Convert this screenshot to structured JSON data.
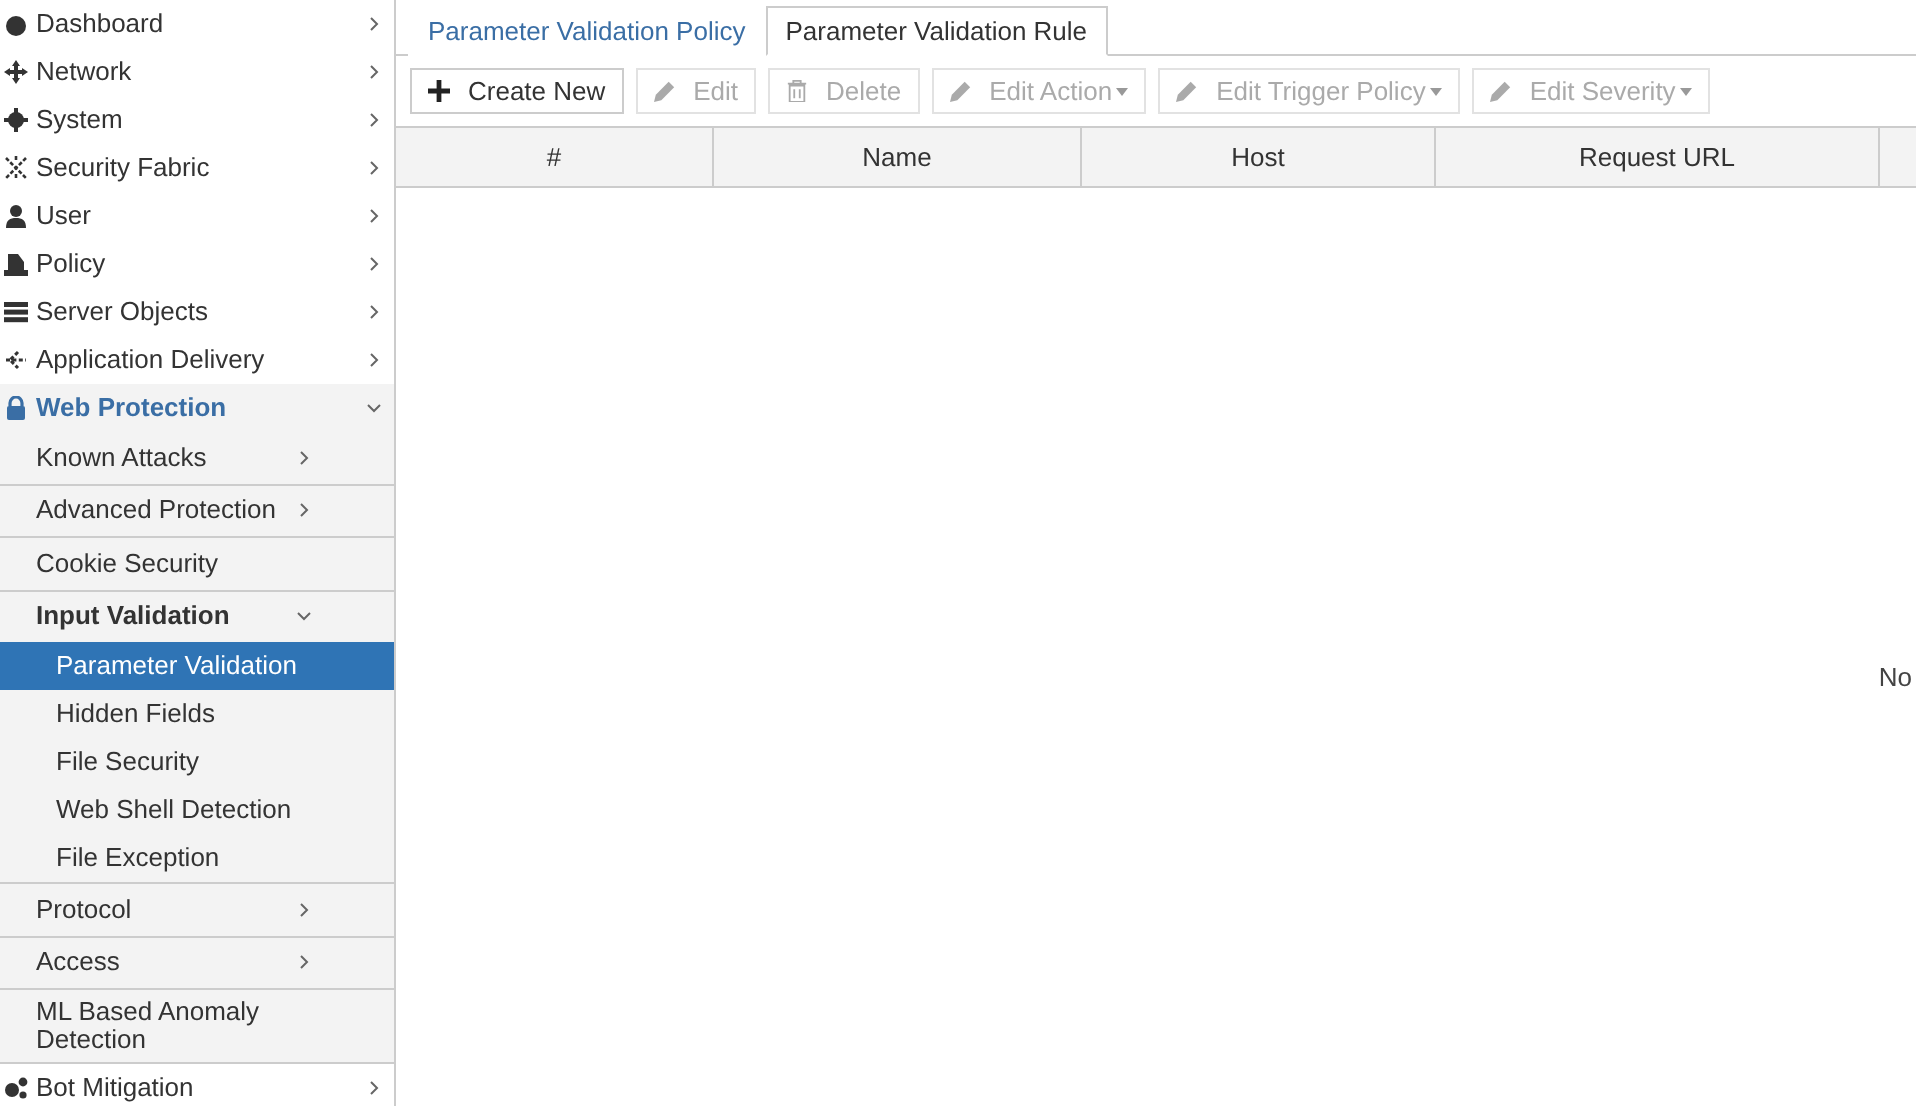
{
  "sidebar": {
    "items": [
      {
        "label": "Dashboard",
        "expanded": false
      },
      {
        "label": "Network",
        "expanded": false
      },
      {
        "label": "System",
        "expanded": false
      },
      {
        "label": "Security Fabric",
        "expanded": false
      },
      {
        "label": "User",
        "expanded": false
      },
      {
        "label": "Policy",
        "expanded": false
      },
      {
        "label": "Server Objects",
        "expanded": false
      },
      {
        "label": "Application Delivery",
        "expanded": false
      },
      {
        "label": "Web Protection",
        "expanded": true,
        "children": [
          {
            "label": "Known Attacks",
            "expanded": false
          },
          {
            "label": "Advanced Protection",
            "expanded": false
          },
          {
            "label": "Cookie Security"
          },
          {
            "label": "Input Validation",
            "expanded": true,
            "children": [
              {
                "label": "Parameter Validation",
                "selected": true
              },
              {
                "label": "Hidden Fields",
                "selected": false
              },
              {
                "label": "File Security",
                "selected": false
              },
              {
                "label": "Web Shell Detection",
                "selected": false
              },
              {
                "label": "File Exception",
                "selected": false
              }
            ]
          },
          {
            "label": "Protocol",
            "expanded": false
          },
          {
            "label": "Access",
            "expanded": false
          },
          {
            "label": "ML Based Anomaly Detection"
          }
        ]
      },
      {
        "label": "Bot Mitigation",
        "expanded": false
      }
    ]
  },
  "tabs": [
    {
      "label": "Parameter Validation Policy",
      "selected": false
    },
    {
      "label": "Parameter Validation Rule",
      "selected": true
    }
  ],
  "toolbar": [
    {
      "kind": "create",
      "label": "Create New",
      "disabled": false
    },
    {
      "kind": "edit",
      "label": "Edit",
      "disabled": true
    },
    {
      "kind": "delete",
      "label": "Delete",
      "disabled": true
    },
    {
      "kind": "edit",
      "label": "Edit Action",
      "disabled": true,
      "dropdown": true
    },
    {
      "kind": "edit",
      "label": "Edit Trigger Policy",
      "disabled": true,
      "dropdown": true
    },
    {
      "kind": "edit",
      "label": "Edit Severity",
      "disabled": true,
      "dropdown": true
    }
  ],
  "table": {
    "columns": [
      "#",
      "Name",
      "Host",
      "Request URL"
    ],
    "empty_message": "No"
  }
}
